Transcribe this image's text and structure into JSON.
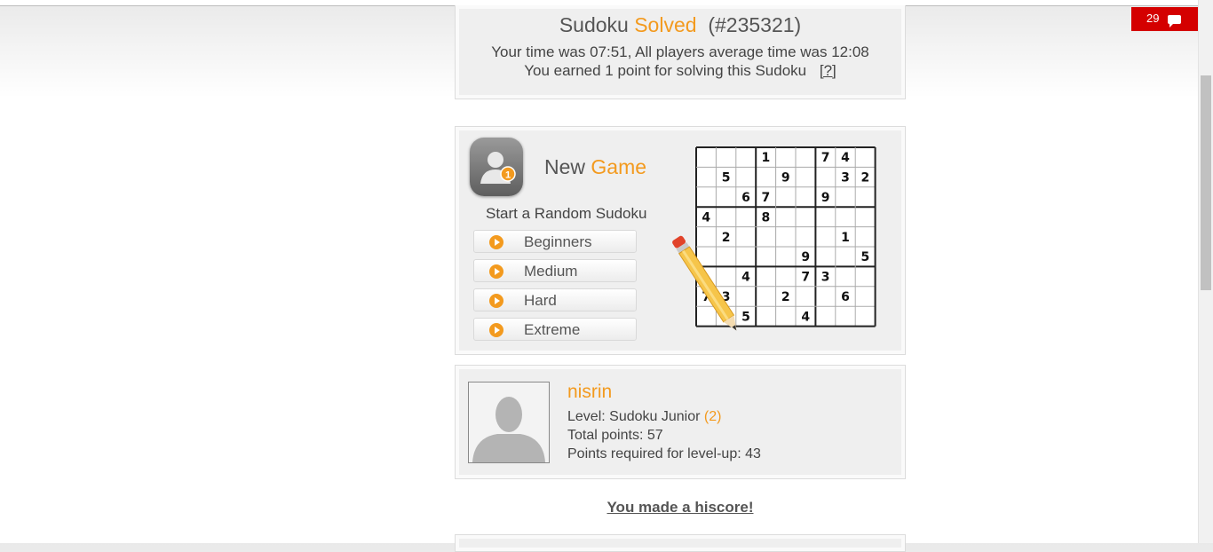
{
  "solved": {
    "title_prefix": "Sudoku",
    "title_highlight": "Solved",
    "puzzle_id": "(#235321)",
    "time_text": "Your time was 07:51, All players average time was 12:08",
    "points_text": "You earned 1 point for solving this Sudoku",
    "help_link": "[?]"
  },
  "new_game": {
    "title_prefix": "New",
    "title_highlight": "Game",
    "badge_number": "1",
    "start_label": "Start a Random Sudoku",
    "levels": [
      "Beginners",
      "Medium",
      "Hard",
      "Extreme"
    ]
  },
  "sudoku_grid": {
    "rows": [
      [
        "",
        "",
        "",
        "1",
        "",
        "",
        "7",
        "4",
        ""
      ],
      [
        "",
        "5",
        "",
        "",
        "9",
        "",
        "",
        "3",
        "2"
      ],
      [
        "",
        "",
        "6",
        "7",
        "",
        "",
        "9",
        "",
        ""
      ],
      [
        "4",
        "",
        "",
        "8",
        "",
        "",
        "",
        "",
        ""
      ],
      [
        "",
        "2",
        "",
        "",
        "",
        "",
        "",
        "1",
        ""
      ],
      [
        "",
        "",
        "",
        "",
        "",
        "9",
        "",
        "",
        "5"
      ],
      [
        "",
        "",
        "4",
        "",
        "",
        "7",
        "3",
        "",
        ""
      ],
      [
        "7",
        "3",
        "",
        "",
        "2",
        "",
        "",
        "6",
        ""
      ],
      [
        "",
        "",
        "5",
        "",
        "",
        "4",
        "",
        "",
        ""
      ]
    ]
  },
  "profile": {
    "username": "nisrin",
    "level_label": "Level: Sudoku Junior",
    "level_number": "(2)",
    "total_points": "Total points: 57",
    "points_required": "Points required for level-up: 43"
  },
  "hiscore_link": "You made a hiscore!",
  "notifications": {
    "count": "29"
  },
  "colors": {
    "accent": "#f39a1e",
    "notification": "#d40000",
    "panel": "#efefef"
  }
}
